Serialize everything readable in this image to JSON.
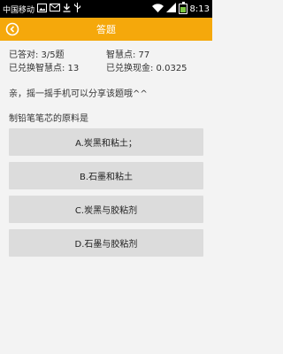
{
  "status_bar": {
    "carrier": "中国移动",
    "time": "8:13",
    "icons_left": [
      "image-icon",
      "mail-icon",
      "download-icon",
      "usb-icon"
    ],
    "icons_right": [
      "wifi-icon",
      "signal-icon",
      "battery-icon"
    ],
    "battery_level": 0.75
  },
  "app_bar": {
    "title": "答题",
    "back_icon": "back-arrow-icon",
    "color": "#f5a80b"
  },
  "stats": {
    "answered": "已答对: 3/5题",
    "wisdom_points": "智慧点: 77",
    "redeemed_points": "已兑换智慧点: 13",
    "redeemed_cash": "已兑换现金: 0.0325"
  },
  "share_tip": "亲，摇一摇手机可以分享该题哦^^",
  "question": "制铅笔笔芯的原料是",
  "options": [
    {
      "label": "A.炭黑和粘土；"
    },
    {
      "label": "B.石墨和粘土"
    },
    {
      "label": "C.炭黑与胶粘剂"
    },
    {
      "label": "D.石墨与胶粘剂"
    }
  ]
}
